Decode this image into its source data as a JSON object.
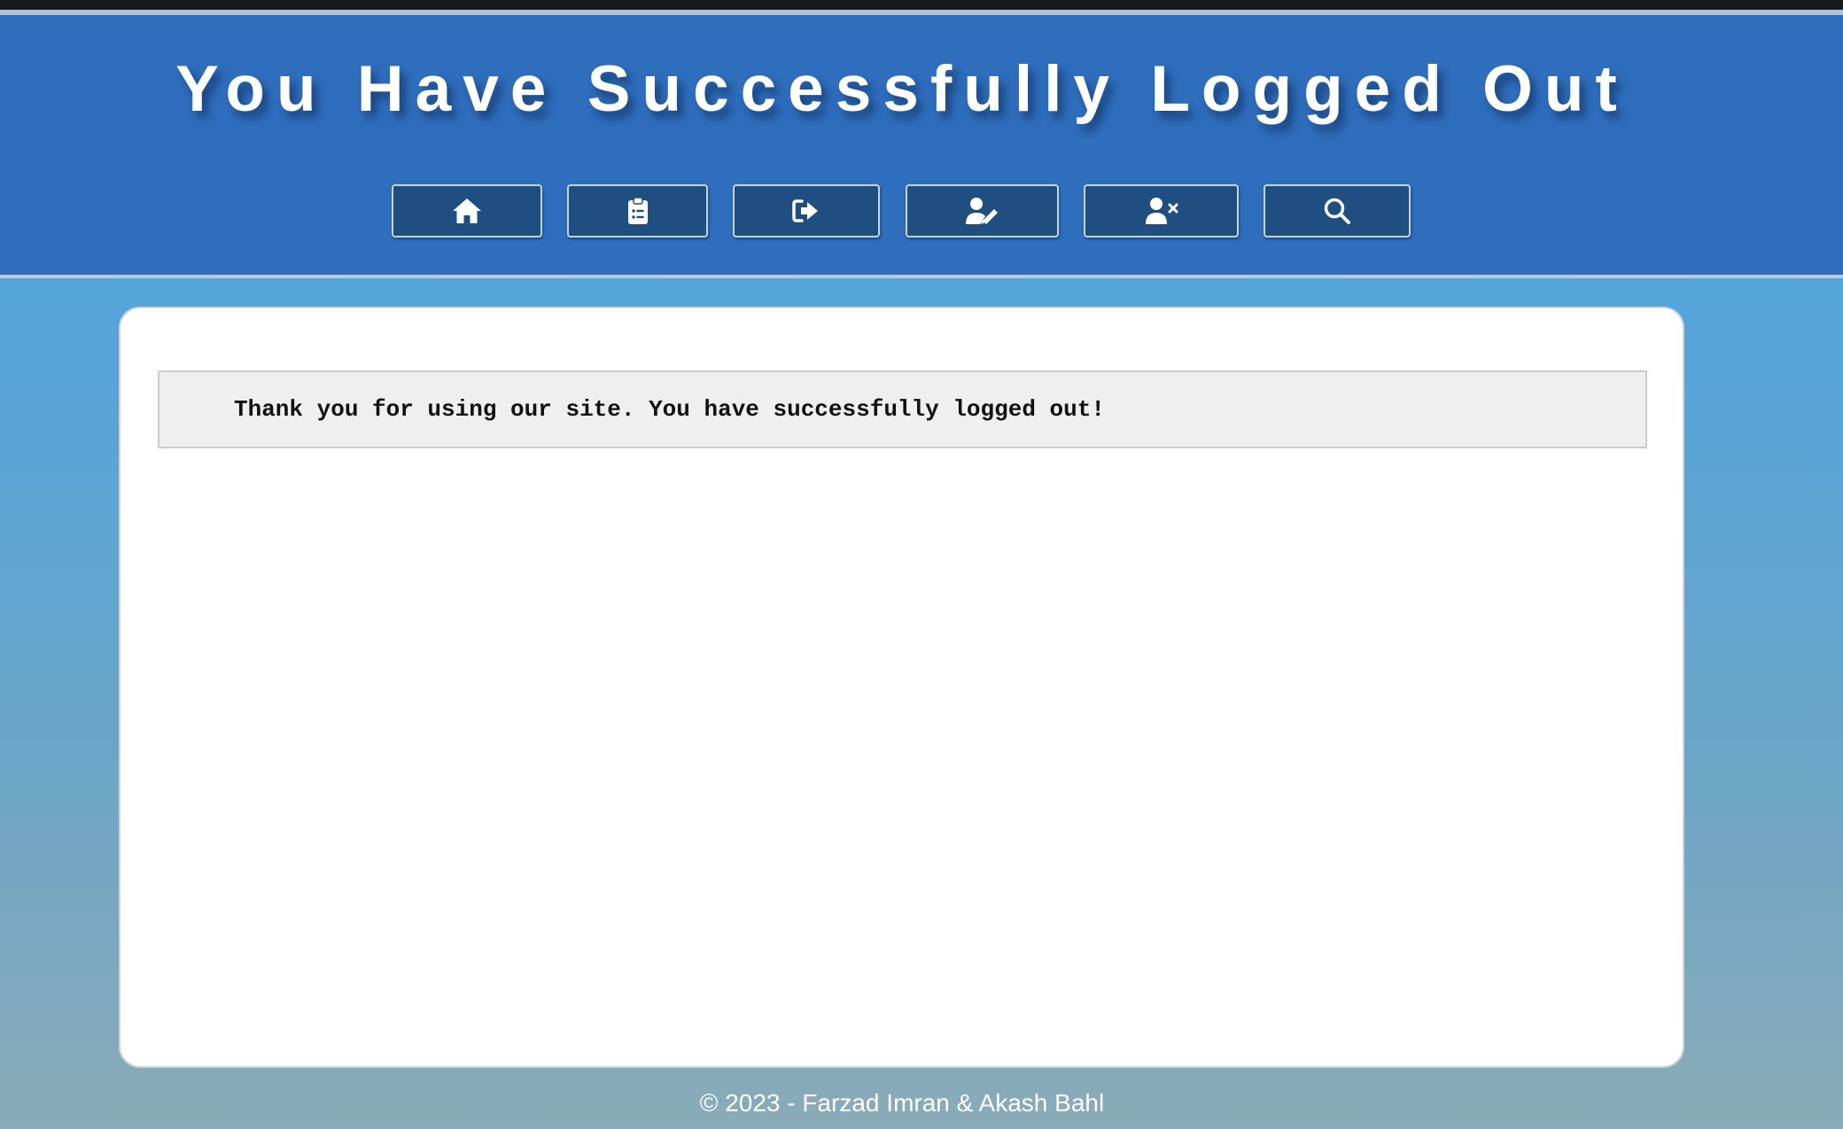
{
  "header": {
    "title": "You Have Successfully Logged Out"
  },
  "nav": {
    "buttons": [
      {
        "icon": "home-icon",
        "name": "home-button"
      },
      {
        "icon": "clipboard-list-icon",
        "name": "clipboard-button"
      },
      {
        "icon": "sign-out-icon",
        "name": "logout-button"
      },
      {
        "icon": "user-edit-icon",
        "name": "edit-user-button"
      },
      {
        "icon": "user-remove-icon",
        "name": "remove-user-button"
      },
      {
        "icon": "search-icon",
        "name": "search-button"
      }
    ]
  },
  "main": {
    "message": "Thank you for using our site. You have successfully logged out!"
  },
  "footer": {
    "copyright": "© 2023 - Farzad Imran & Akash Bahl"
  },
  "colors": {
    "header_bg": "#2e6ebd",
    "button_bg": "#1f4e80",
    "background_top": "#4da4e0",
    "background_bottom": "#8aabb8"
  }
}
